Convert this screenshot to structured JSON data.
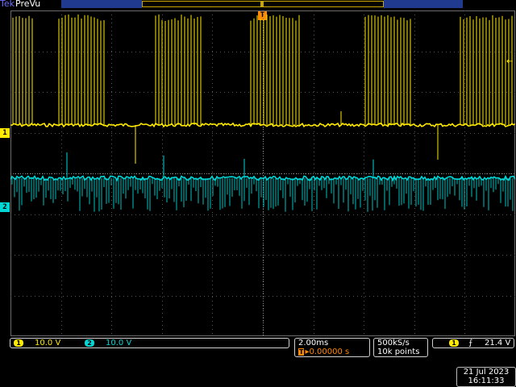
{
  "header": {
    "brand": "Tek",
    "mode": "PreVu"
  },
  "markers": {
    "trigger_position": "T",
    "channel1_ground": "1",
    "channel2_ground": "2",
    "trigger_level_arrow": "←"
  },
  "colors": {
    "channel1": "#ffea00",
    "channel2": "#00d7d7",
    "trigger": "#ff8a00",
    "graticule": "#555555"
  },
  "channels": [
    {
      "badge": "1",
      "scale": "10.0 V"
    },
    {
      "badge": "2",
      "scale": "10.0 V"
    }
  ],
  "timebase": {
    "scale": "2.00ms",
    "trigger_icon": "T",
    "arrow": "▸",
    "offset": "0.00000 s"
  },
  "acquisition": {
    "sample_rate": "500kS/s",
    "record_length": "10k points"
  },
  "trigger": {
    "source_badge": "1",
    "slope_icon": "rising-edge-icon",
    "slope_glyph": "⨍",
    "level": "21.4 V"
  },
  "datetime": {
    "date": "21 Jul  2023",
    "time": "16:11:33"
  }
}
